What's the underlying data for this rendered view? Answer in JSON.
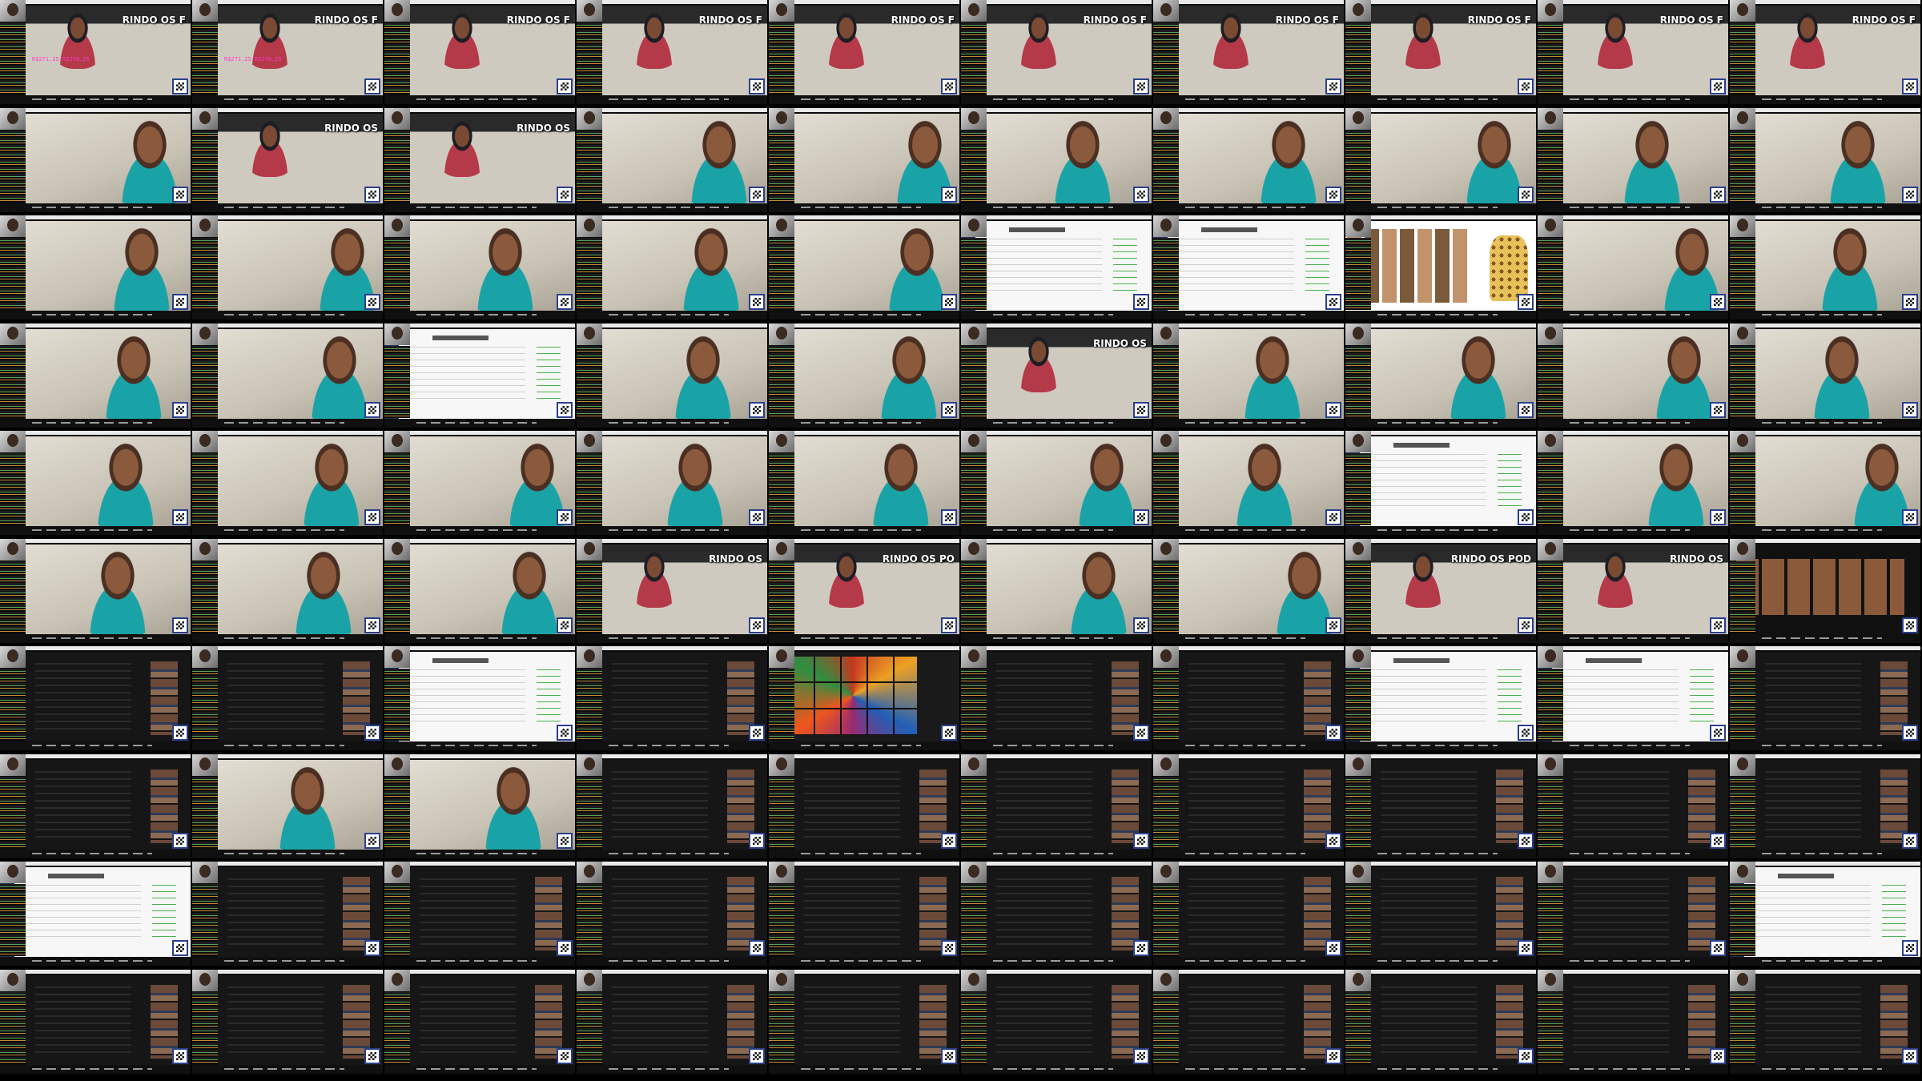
{
  "grid": {
    "columns": 10,
    "rows": 10
  },
  "overlay_texts": {
    "red_stream": [
      "RINDO OS F",
      "RINDO OS F",
      "RINDO OS F",
      "RINDO OS F",
      "RINDO OS F",
      "RINDO OS F",
      "RINDO OS F",
      "RINDO OS F",
      "RINDO OS F",
      "RINDO OS F",
      "RINDO OS",
      "RINDO OS",
      "RINDO OS",
      "RINDO OS",
      "RINDO OS PO",
      "RINDO OS POD",
      "RINDO OS",
      "RINDO OS"
    ],
    "prices": [
      "R$271,25   R$270,25",
      "R$271,25   R$270,25"
    ]
  },
  "tile_kinds": [
    "red",
    "red",
    "red",
    "red",
    "red",
    "red",
    "red",
    "red",
    "red",
    "red",
    "teal",
    "red",
    "red",
    "teal",
    "teal",
    "teal",
    "teal",
    "teal",
    "teal",
    "teal",
    "teal",
    "teal",
    "teal",
    "teal",
    "teal",
    "white",
    "white",
    "gallery",
    "teal",
    "teal",
    "teal",
    "teal",
    "white",
    "teal",
    "teal",
    "red",
    "teal",
    "teal",
    "teal",
    "teal",
    "teal",
    "teal",
    "teal",
    "teal",
    "teal",
    "teal",
    "teal",
    "white",
    "teal",
    "teal",
    "teal",
    "teal",
    "teal",
    "red",
    "red",
    "teal",
    "teal",
    "red",
    "red",
    "dark-gallery",
    "dark",
    "dark",
    "white",
    "dark",
    "collage",
    "dark",
    "dark",
    "white",
    "white",
    "dark",
    "dark",
    "teal",
    "teal",
    "dark",
    "dark",
    "dark",
    "dark",
    "dark",
    "dark",
    "dark",
    "white",
    "dark",
    "dark",
    "dark",
    "dark",
    "dark",
    "dark",
    "dark",
    "dark",
    "white",
    "dark",
    "dark",
    "dark",
    "dark",
    "dark",
    "dark",
    "dark",
    "dark",
    "dark",
    "dark"
  ],
  "colors": {
    "background": "#000000",
    "teal_shirt": "#1aa3a6",
    "red_shirt": "#b43a4a",
    "price_pink": "#ff3cc8",
    "qr_border": "#2b3f8c"
  }
}
